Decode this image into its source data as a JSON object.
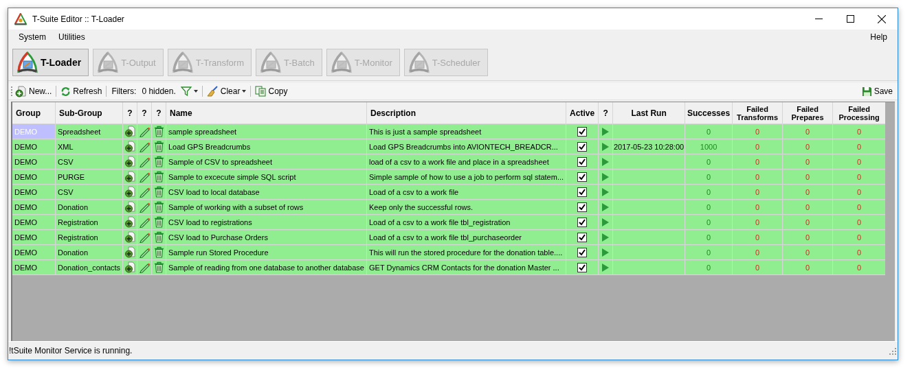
{
  "window": {
    "title": "T-Suite Editor :: T-Loader"
  },
  "menu": {
    "items": [
      "System",
      "Utilities"
    ],
    "help": "Help"
  },
  "modules": [
    {
      "label": "T-Loader",
      "disabled": false
    },
    {
      "label": "T-Output",
      "disabled": true
    },
    {
      "label": "T-Transform",
      "disabled": true
    },
    {
      "label": "T-Batch",
      "disabled": true
    },
    {
      "label": "T-Monitor",
      "disabled": true
    },
    {
      "label": "T-Scheduler",
      "disabled": true
    }
  ],
  "toolbar": {
    "new": "New...",
    "refresh": "Refresh",
    "filters_label": "Filters:",
    "hidden_count": "0 hidden.",
    "clear": "Clear",
    "copy": "Copy",
    "save": "Save"
  },
  "table": {
    "columns": [
      "Group",
      "Sub-Group",
      "?",
      "?",
      "?",
      "Name",
      "Description",
      "Active",
      "?",
      "Last Run",
      "Successes",
      "Failed Transforms",
      "Failed Prepares",
      "Failed Processing"
    ],
    "rows": [
      {
        "selected": true,
        "group": "DEMO",
        "sub_group": "Spreadsheet",
        "name": "sample spreadsheet",
        "description": "This is just a sample spreadsheet",
        "active": true,
        "last_run": "",
        "successes": "0",
        "failed_transforms": "0",
        "failed_prepares": "0",
        "failed_processing": "0"
      },
      {
        "selected": false,
        "group": "DEMO",
        "sub_group": "XML",
        "name": "Load GPS Breadcrumbs",
        "description": "Load GPS Breadcrumbs into AVIONTECH_BREADCR...",
        "active": true,
        "last_run": "2017-05-23 10:28:00",
        "successes": "1000",
        "failed_transforms": "0",
        "failed_prepares": "0",
        "failed_processing": "0"
      },
      {
        "selected": false,
        "group": "DEMO",
        "sub_group": "CSV",
        "name": "Sample of CSV to spreadsheet",
        "description": "load of a csv to a work file and place in a spreadsheet",
        "active": true,
        "last_run": "",
        "successes": "0",
        "failed_transforms": "0",
        "failed_prepares": "0",
        "failed_processing": "0"
      },
      {
        "selected": false,
        "group": "DEMO",
        "sub_group": "PURGE",
        "name": "Sample to excecute simple SQL script",
        "description": "Simple sample of how to use a job to perform sql statem...",
        "active": true,
        "last_run": "",
        "successes": "0",
        "failed_transforms": "0",
        "failed_prepares": "0",
        "failed_processing": "0"
      },
      {
        "selected": false,
        "group": "DEMO",
        "sub_group": "CSV",
        "name": "CSV load to local database",
        "description": "Load of a csv to a work file",
        "active": true,
        "last_run": "",
        "successes": "0",
        "failed_transforms": "0",
        "failed_prepares": "0",
        "failed_processing": "0"
      },
      {
        "selected": false,
        "group": "DEMO",
        "sub_group": "Donation",
        "name": "Sample of working with a subset of rows",
        "description": "Keep only the successful rows.",
        "active": true,
        "last_run": "",
        "successes": "0",
        "failed_transforms": "0",
        "failed_prepares": "0",
        "failed_processing": "0"
      },
      {
        "selected": false,
        "group": "DEMO",
        "sub_group": "Registration",
        "name": "CSV load to registrations",
        "description": "Load of a csv to a work file tbl_registration",
        "active": true,
        "last_run": "",
        "successes": "0",
        "failed_transforms": "0",
        "failed_prepares": "0",
        "failed_processing": "0"
      },
      {
        "selected": false,
        "group": "DEMO",
        "sub_group": "Registration",
        "name": "CSV load to Purchase Orders",
        "description": "Load of a csv to a work file tbl_purchaseorder",
        "active": true,
        "last_run": "",
        "successes": "0",
        "failed_transforms": "0",
        "failed_prepares": "0",
        "failed_processing": "0"
      },
      {
        "selected": false,
        "group": "DEMO",
        "sub_group": "Donation",
        "name": "Sample run Stored Procedure",
        "description": "This will run the stored procedure for the donation table....",
        "active": true,
        "last_run": "",
        "successes": "0",
        "failed_transforms": "0",
        "failed_prepares": "0",
        "failed_processing": "0"
      },
      {
        "selected": false,
        "group": "DEMO",
        "sub_group": "Donation_contacts",
        "name": "Sample of reading from one database to another database",
        "description": "GET Dynamics CRM  Contacts for the donation Master ...",
        "active": true,
        "last_run": "",
        "successes": "0",
        "failed_transforms": "0",
        "failed_prepares": "0",
        "failed_processing": "0"
      }
    ]
  },
  "status_bar": "!tSuite Monitor Service is running."
}
